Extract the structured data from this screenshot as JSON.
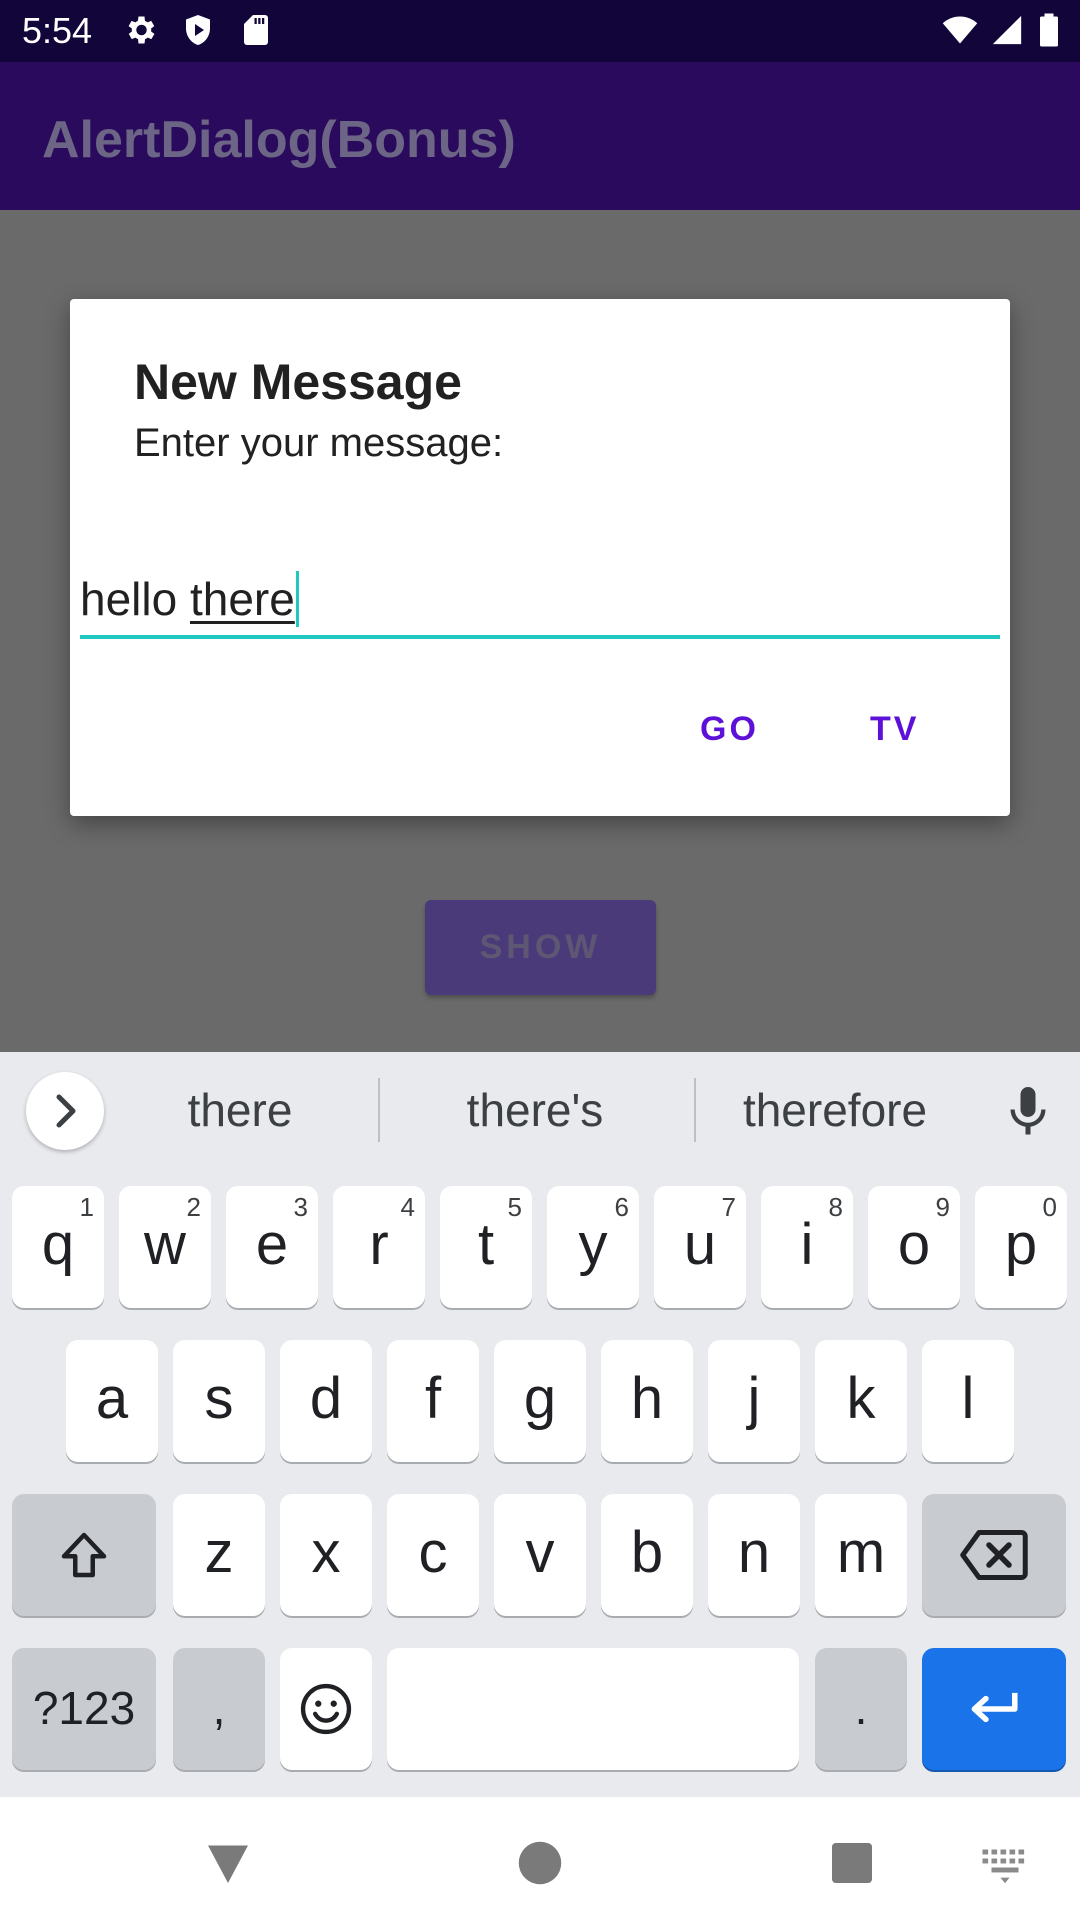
{
  "status_bar": {
    "time": "5:54",
    "icons": [
      "settings-icon",
      "play-protect-icon",
      "sd-card-icon",
      "wifi-icon",
      "signal-icon",
      "battery-icon"
    ]
  },
  "app_bar": {
    "title": "AlertDialog(Bonus)"
  },
  "background": {
    "show_button_label": "SHOW"
  },
  "dialog": {
    "title": "New Message",
    "message": "Enter your message:",
    "input": {
      "committed_text": "hello ",
      "composing_text": "there"
    },
    "buttons": {
      "go_label": "GO",
      "tv_label": "TV"
    },
    "accent_color": "#1fc8c0",
    "button_color": "#5d10d8"
  },
  "keyboard": {
    "suggestions": [
      "there",
      "there's",
      "therefore"
    ],
    "row1": [
      {
        "key": "q",
        "hint": "1"
      },
      {
        "key": "w",
        "hint": "2"
      },
      {
        "key": "e",
        "hint": "3"
      },
      {
        "key": "r",
        "hint": "4"
      },
      {
        "key": "t",
        "hint": "5"
      },
      {
        "key": "y",
        "hint": "6"
      },
      {
        "key": "u",
        "hint": "7"
      },
      {
        "key": "i",
        "hint": "8"
      },
      {
        "key": "o",
        "hint": "9"
      },
      {
        "key": "p",
        "hint": "0"
      }
    ],
    "row2": [
      "a",
      "s",
      "d",
      "f",
      "g",
      "h",
      "j",
      "k",
      "l"
    ],
    "row3": [
      "z",
      "x",
      "c",
      "v",
      "b",
      "n",
      "m"
    ],
    "row4": {
      "symbols_label": "?123",
      "comma_label": ",",
      "period_label": "."
    },
    "enter_color": "#1a73e8"
  },
  "nav_bar": {
    "icons": [
      "back-icon",
      "home-icon",
      "recents-icon",
      "keyboard-switch-icon"
    ]
  }
}
